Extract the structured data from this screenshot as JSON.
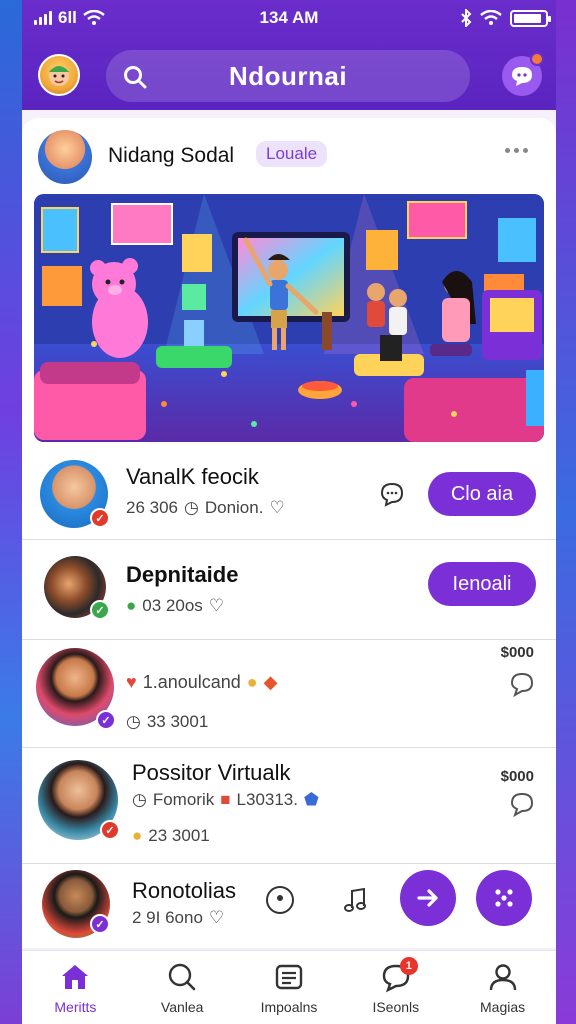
{
  "status_bar": {
    "carrier": "6ll",
    "time": "134 AM"
  },
  "header": {
    "title": "Ndournai",
    "search_icon": "search-icon",
    "avatar_icon": "avatar",
    "chat_icon": "chat-bubble-icon"
  },
  "card": {
    "name": "Nidang Sodal",
    "badge": "Louale",
    "more_icon": "more-horizontal-icon"
  },
  "rows": [
    {
      "title": "VanalK feocik",
      "meta_text": "26 306",
      "meta_text2": "Donion.",
      "button": "Clo aia",
      "verify_color": "#e23a2a"
    },
    {
      "title": "Depnitaide",
      "meta_text": "03 20os",
      "button": "Ienoali",
      "verify_color": "#3aa84a"
    },
    {
      "title": "",
      "meta_text": "1.anoulcand",
      "meta_text2": "33 3001",
      "price": "$000",
      "verify_color": "#7b2fd6"
    },
    {
      "title": "Possitor Virtualk",
      "meta_text": "Fomorik",
      "meta_text_b": "L30313.",
      "meta_text2": "23 3001",
      "price": "$000",
      "verify_color": "#e23a2a"
    },
    {
      "title": "Ronotolias",
      "meta_text": "2 9I 6ono",
      "verify_color": "#7b2fd6"
    }
  ],
  "bottom_nav": [
    {
      "label": "Meritts",
      "icon": "home-icon",
      "active": true
    },
    {
      "label": "Vanlea",
      "icon": "search-chat-icon",
      "active": false
    },
    {
      "label": "Impoalns",
      "icon": "news-icon",
      "active": false
    },
    {
      "label": "ISeonls",
      "icon": "message-icon",
      "badge": "1",
      "active": false
    },
    {
      "label": "Magias",
      "icon": "profile-icon",
      "active": false
    }
  ],
  "colors": {
    "accent": "#7b2fd6",
    "header": "#6a2dcc"
  }
}
